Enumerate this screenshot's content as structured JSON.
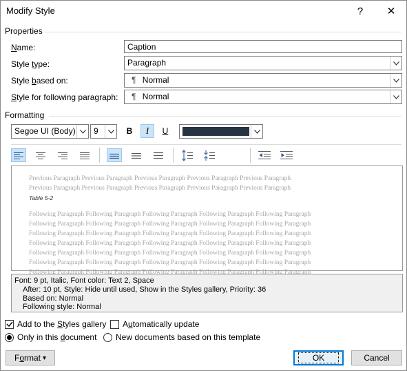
{
  "window": {
    "title": "Modify Style",
    "help_label": "?",
    "close_label": "✕"
  },
  "properties": {
    "group_label": "Properties",
    "name_label_pre": "",
    "name_label_u": "N",
    "name_label_post": "ame:",
    "name_value": "Caption",
    "style_type_label_pre": "Style ",
    "style_type_label_u": "t",
    "style_type_label_post": "ype:",
    "style_type_value": "Paragraph",
    "based_on_label_pre": "Style ",
    "based_on_label_u": "b",
    "based_on_label_post": "ased on:",
    "based_on_value": "Normal",
    "following_label_pre": "",
    "following_label_u": "S",
    "following_label_post": "tyle for following paragraph:",
    "following_value": "Normal",
    "pilcrow": "¶"
  },
  "formatting": {
    "group_label": "Formatting",
    "font_name": "Segoe UI (Body)",
    "font_size": "9",
    "bold": "B",
    "italic": "I",
    "underline": "U",
    "font_color": "#263443"
  },
  "preview": {
    "previous_lines": [
      "Previous Paragraph Previous Paragraph Previous Paragraph Previous Paragraph Previous Paragraph",
      "Previous Paragraph Previous Paragraph Previous Paragraph Previous Paragraph Previous Paragraph"
    ],
    "caption": "Table 5-2",
    "following_lines": [
      "Following Paragraph Following Paragraph Following Paragraph Following Paragraph Following Paragraph",
      "Following Paragraph Following Paragraph Following Paragraph Following Paragraph Following Paragraph",
      "Following Paragraph Following Paragraph Following Paragraph Following Paragraph Following Paragraph",
      "Following Paragraph Following Paragraph Following Paragraph Following Paragraph Following Paragraph",
      "Following Paragraph Following Paragraph Following Paragraph Following Paragraph Following Paragraph",
      "Following Paragraph Following Paragraph Following Paragraph Following Paragraph Following Paragraph",
      "Following Paragraph Following Paragraph Following Paragraph Following Paragraph Following Paragraph"
    ]
  },
  "description": {
    "line1": "Font: 9 pt, Italic, Font color: Text 2, Space",
    "line2": "After:  10 pt, Style: Hide until used, Show in the Styles gallery, Priority: 36",
    "line3": "Based on: Normal",
    "line4": "Following style: Normal"
  },
  "options": {
    "add_gallery_pre": "Add to the ",
    "add_gallery_u": "S",
    "add_gallery_post": "tyles gallery",
    "add_gallery_checked": true,
    "auto_update_pre": "A",
    "auto_update_u": "u",
    "auto_update_post": "tomatically update",
    "auto_update_checked": false,
    "only_doc_pre": "Only in this ",
    "only_doc_u": "d",
    "only_doc_post": "ocument",
    "only_doc_selected": true,
    "new_docs_label": "New documents based on this template",
    "new_docs_selected": false
  },
  "buttons": {
    "format_pre": "F",
    "format_u": "o",
    "format_post": "rmat",
    "format_caret": "▾",
    "ok_label": "OK",
    "cancel_label": "Cancel"
  }
}
